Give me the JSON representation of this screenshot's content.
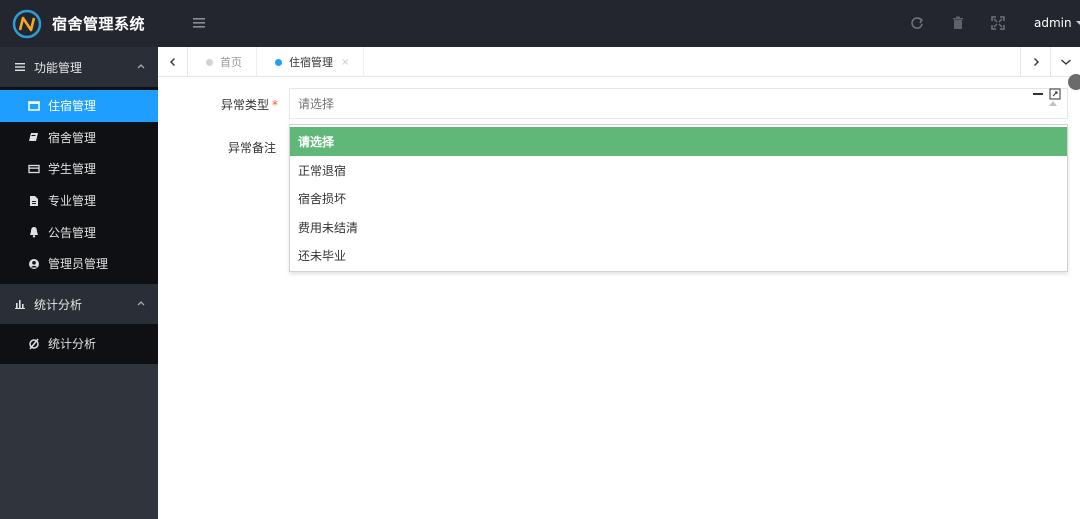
{
  "app": {
    "title": "宿舍管理系统"
  },
  "header": {
    "icons": [
      "refresh-icon",
      "trash-icon",
      "fullscreen-icon"
    ],
    "user": "admin"
  },
  "sidebar": {
    "groups": [
      {
        "label": "功能管理",
        "items": [
          {
            "label": "住宿管理",
            "icon": "window-icon",
            "active": true
          },
          {
            "label": "宿舍管理",
            "icon": "book-icon"
          },
          {
            "label": "学生管理",
            "icon": "card-icon"
          },
          {
            "label": "专业管理",
            "icon": "file-icon"
          },
          {
            "label": "公告管理",
            "icon": "bell-icon"
          },
          {
            "label": "管理员管理",
            "icon": "user-circle-icon"
          }
        ]
      },
      {
        "label": "统计分析",
        "items": [
          {
            "label": "统计分析",
            "icon": "spinner-icon"
          }
        ]
      }
    ]
  },
  "tabs": [
    {
      "label": "首页",
      "active": false
    },
    {
      "label": "住宿管理",
      "active": true,
      "close": "×"
    }
  ],
  "form": {
    "field1": {
      "label": "异常类型",
      "required": "*",
      "placeholder": "请选择",
      "options": [
        "请选择",
        "正常退宿",
        "宿舍损坏",
        "费用未结清",
        "还未毕业"
      ]
    },
    "field2": {
      "label": "异常备注"
    }
  },
  "colors": {
    "header_bg": "#23262e",
    "sidebar_bg": "#2f343d",
    "active_item": "#1e9fff",
    "selected_option": "#5fb878",
    "required": "#ff5722"
  }
}
